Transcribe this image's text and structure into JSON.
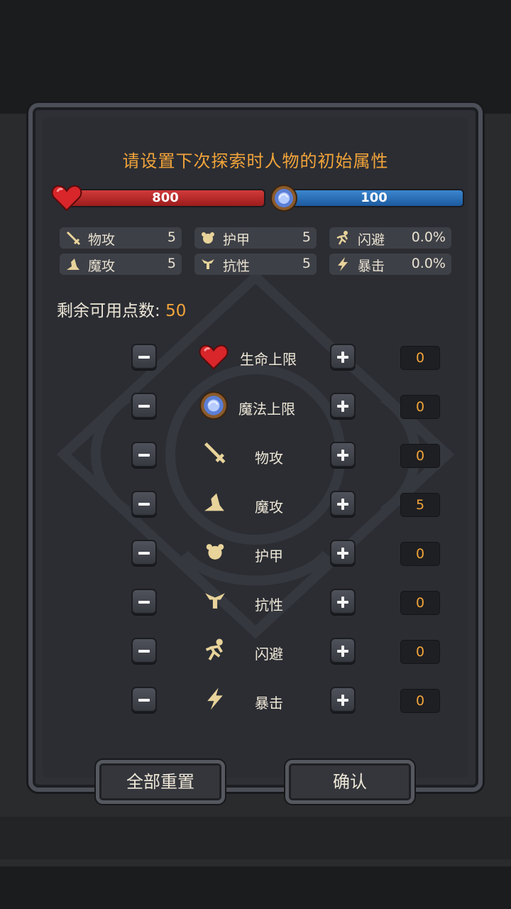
{
  "title": "请设置下次探索时人物的初始属性",
  "hp": "800",
  "mp": "100",
  "stats": [
    {
      "icon": "sword-icon",
      "label": "物攻",
      "value": "5"
    },
    {
      "icon": "armor-icon",
      "label": "护甲",
      "value": "5"
    },
    {
      "icon": "dodge-icon",
      "label": "闪避",
      "value": "0.0%"
    },
    {
      "icon": "magic-hat-icon",
      "label": "魔攻",
      "value": "5"
    },
    {
      "icon": "resist-icon",
      "label": "抗性",
      "value": "5"
    },
    {
      "icon": "crit-icon",
      "label": "暴击",
      "value": "0.0%"
    }
  ],
  "remaining_label": "剩余可用点数:",
  "remaining_value": "50",
  "attributes": [
    {
      "icon": "heart-icon",
      "label": "生命上限",
      "value": "0"
    },
    {
      "icon": "mana-orb-icon",
      "label": "魔法上限",
      "value": "0"
    },
    {
      "icon": "sword-icon",
      "label": "物攻",
      "value": "0"
    },
    {
      "icon": "magic-hat-icon",
      "label": "魔攻",
      "value": "5"
    },
    {
      "icon": "armor-icon",
      "label": "护甲",
      "value": "0"
    },
    {
      "icon": "resist-icon",
      "label": "抗性",
      "value": "0"
    },
    {
      "icon": "dodge-icon",
      "label": "闪避",
      "value": "0"
    },
    {
      "icon": "crit-icon",
      "label": "暴击",
      "value": "0"
    }
  ],
  "reset_label": "全部重置",
  "confirm_label": "确认",
  "colors": {
    "accent": "#f2a43a",
    "hp": "#c62d2d",
    "mp": "#2b6fb6",
    "panel": "#2e3036"
  }
}
